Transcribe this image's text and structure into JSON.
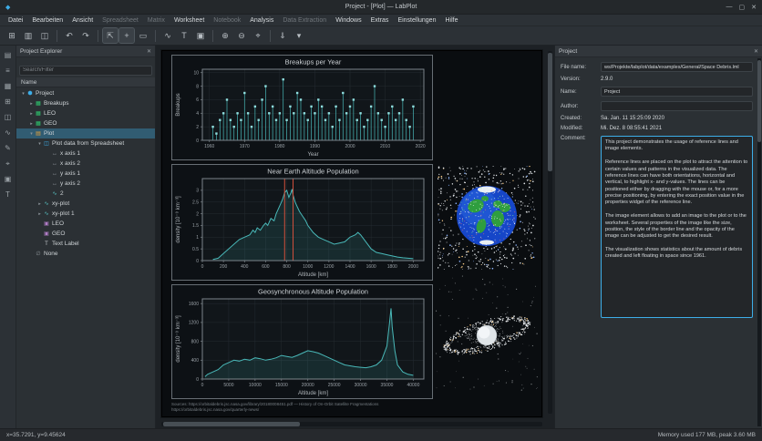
{
  "window": {
    "title": "Project - [Plot] — LabPlot",
    "controls": {
      "minimize": "—",
      "maximize": "▢",
      "close": "✕"
    }
  },
  "menubar": {
    "items": [
      {
        "label": "Datei",
        "dimmed": false
      },
      {
        "label": "Bearbeiten",
        "dimmed": false
      },
      {
        "label": "Ansicht",
        "dimmed": false
      },
      {
        "label": "Spreadsheet",
        "dimmed": true
      },
      {
        "label": "Matrix",
        "dimmed": true
      },
      {
        "label": "Worksheet",
        "dimmed": false
      },
      {
        "label": "Notebook",
        "dimmed": true
      },
      {
        "label": "Analysis",
        "dimmed": false
      },
      {
        "label": "Data Extraction",
        "dimmed": true
      },
      {
        "label": "Windows",
        "dimmed": false
      },
      {
        "label": "Extras",
        "dimmed": false
      },
      {
        "label": "Einstellungen",
        "dimmed": false
      },
      {
        "label": "Hilfe",
        "dimmed": false
      }
    ]
  },
  "toolbar": {
    "items": [
      {
        "name": "new-icon",
        "glyph": "⊞"
      },
      {
        "name": "open-icon",
        "glyph": "▥"
      },
      {
        "name": "save-icon",
        "glyph": "◫"
      },
      {
        "sep": true
      },
      {
        "name": "undo-icon",
        "glyph": "↶"
      },
      {
        "name": "redo-icon",
        "glyph": "↷"
      },
      {
        "sep": true
      },
      {
        "name": "select-mode-icon",
        "glyph": "⇱",
        "active": true
      },
      {
        "name": "pan-mode-icon",
        "glyph": "+",
        "active": true
      },
      {
        "name": "zoom-select-icon",
        "glyph": "▭"
      },
      {
        "sep": true
      },
      {
        "name": "add-plot-icon",
        "glyph": "∿"
      },
      {
        "name": "add-text-label-icon",
        "glyph": "T"
      },
      {
        "name": "add-image-icon",
        "glyph": "▣"
      },
      {
        "sep": true
      },
      {
        "name": "zoom-in-icon",
        "glyph": "⊕"
      },
      {
        "name": "zoom-out-icon",
        "glyph": "⊖"
      },
      {
        "name": "zoom-fit-icon",
        "glyph": "⌖"
      },
      {
        "sep": true
      },
      {
        "name": "export-icon",
        "glyph": "⇓"
      },
      {
        "name": "more-dropdown-icon",
        "glyph": "▾"
      }
    ]
  },
  "dock": {
    "items": [
      {
        "name": "dock-project-explorer-icon",
        "glyph": "▤"
      },
      {
        "name": "dock-properties-icon",
        "glyph": "≡"
      },
      {
        "name": "dock-spreadsheet-icon",
        "glyph": "▦"
      },
      {
        "name": "dock-matrix-icon",
        "glyph": "⊞"
      },
      {
        "name": "dock-worksheet-icon",
        "glyph": "◫"
      },
      {
        "name": "dock-plot-icon",
        "glyph": "∿"
      },
      {
        "name": "dock-notebook-icon",
        "glyph": "✎"
      },
      {
        "name": "dock-datapicker-icon",
        "glyph": "⌖"
      },
      {
        "name": "dock-image-icon",
        "glyph": "▣"
      },
      {
        "name": "dock-note-icon",
        "glyph": "T"
      }
    ]
  },
  "project_explorer": {
    "title": "Project Explorer",
    "search_placeholder": "Search/Filter",
    "column_header": "Name",
    "items": [
      {
        "label": "Project",
        "level": 0,
        "icon": "project",
        "expand": "open",
        "selected": false
      },
      {
        "label": "Breakups",
        "level": 1,
        "icon": "spreadsheet",
        "expand": "closed",
        "selected": false
      },
      {
        "label": "LEO",
        "level": 1,
        "icon": "spreadsheet",
        "expand": "closed",
        "selected": false
      },
      {
        "label": "GEO",
        "level": 1,
        "icon": "spreadsheet",
        "expand": "closed",
        "selected": false
      },
      {
        "label": "Plot",
        "level": 1,
        "icon": "worksheet",
        "expand": "open",
        "selected": true
      },
      {
        "label": "Plot data from Spreadsheet",
        "level": 2,
        "icon": "plot",
        "expand": "open",
        "selected": false
      },
      {
        "label": "x axis 1",
        "level": 3,
        "icon": "axis",
        "expand": null,
        "selected": false
      },
      {
        "label": "x axis 2",
        "level": 3,
        "icon": "axis",
        "expand": null,
        "selected": false
      },
      {
        "label": "y axis 1",
        "level": 3,
        "icon": "axis",
        "expand": null,
        "selected": false
      },
      {
        "label": "y axis 2",
        "level": 3,
        "icon": "axis",
        "expand": null,
        "selected": false
      },
      {
        "label": "2",
        "level": 3,
        "icon": "curve",
        "expand": null,
        "selected": false
      },
      {
        "label": "xy-plot",
        "level": 2,
        "icon": "curve",
        "expand": "closed",
        "selected": false
      },
      {
        "label": "xy-plot 1",
        "level": 2,
        "icon": "curve",
        "expand": "closed",
        "selected": false
      },
      {
        "label": "LEO",
        "level": 2,
        "icon": "image",
        "expand": null,
        "selected": false
      },
      {
        "label": "GEO",
        "level": 2,
        "icon": "image",
        "expand": null,
        "selected": false
      },
      {
        "label": "Text Label",
        "level": 2,
        "icon": "label",
        "expand": null,
        "selected": false
      },
      {
        "label": "None",
        "level": 1,
        "icon": "none",
        "expand": null,
        "selected": false
      }
    ]
  },
  "worksheet": {
    "source_lines": [
      "Sources: https://orbitaldebris.jsc.nasa.gov/library/20180008451.pdf — History of On-Orbit Satellite Fragmentations",
      "https://orbitaldebris.jsc.nasa.gov/quarterly-news/"
    ]
  },
  "chart_data": [
    {
      "type": "stem",
      "title": "Breakups per Year",
      "xlabel": "Year",
      "ylabel": "Breakups",
      "xlim": [
        1958,
        2021
      ],
      "ylim": [
        0,
        10.5
      ],
      "xticks": [
        1960,
        1970,
        1980,
        1990,
        2000,
        2010,
        2020
      ],
      "yticks": [
        0,
        2,
        4,
        6,
        8,
        10
      ],
      "grid": true,
      "x": [
        1961,
        1962,
        1963,
        1964,
        1965,
        1966,
        1967,
        1968,
        1969,
        1970,
        1971,
        1972,
        1973,
        1974,
        1975,
        1976,
        1977,
        1978,
        1979,
        1980,
        1981,
        1982,
        1983,
        1984,
        1985,
        1986,
        1987,
        1988,
        1989,
        1990,
        1991,
        1992,
        1993,
        1994,
        1995,
        1996,
        1997,
        1998,
        1999,
        2000,
        2001,
        2002,
        2003,
        2004,
        2005,
        2006,
        2007,
        2008,
        2009,
        2010,
        2011,
        2012,
        2013,
        2014,
        2015,
        2016,
        2017,
        2018
      ],
      "y": [
        2,
        1,
        3,
        4,
        6,
        3,
        2,
        4,
        3,
        7,
        4,
        2,
        5,
        3,
        6,
        8,
        4,
        5,
        3,
        4,
        9,
        3,
        5,
        4,
        7,
        6,
        4,
        3,
        5,
        4,
        6,
        5,
        3,
        4,
        2,
        5,
        3,
        7,
        4,
        5,
        6,
        3,
        4,
        2,
        3,
        5,
        8,
        4,
        3,
        2,
        4,
        5,
        3,
        4,
        6,
        3,
        2,
        5
      ]
    },
    {
      "type": "line",
      "title": "Near Earth Altitude Population",
      "xlabel": "Altitude [km]",
      "ylabel": "density [10⁻⁹ km⁻³]",
      "xlim": [
        0,
        2100
      ],
      "ylim": [
        0,
        3.5
      ],
      "xticks": [
        0,
        200,
        400,
        600,
        800,
        1000,
        1200,
        1400,
        1600,
        1800,
        2000
      ],
      "yticks": [
        0,
        0.5,
        1,
        1.5,
        2,
        2.5,
        3
      ],
      "grid": true,
      "ref_lines_x": [
        780,
        860
      ],
      "ref_color": "#d4503c",
      "x": [
        100,
        150,
        200,
        250,
        300,
        350,
        400,
        450,
        480,
        500,
        520,
        550,
        580,
        600,
        620,
        650,
        680,
        700,
        720,
        740,
        760,
        780,
        800,
        820,
        840,
        850,
        860,
        880,
        900,
        920,
        950,
        980,
        1000,
        1050,
        1100,
        1150,
        1200,
        1250,
        1300,
        1350,
        1400,
        1450,
        1475,
        1500,
        1550,
        1600,
        1650,
        1700,
        1750,
        1800,
        1850,
        1900,
        1950,
        2000
      ],
      "y": [
        0.05,
        0.1,
        0.3,
        0.5,
        0.7,
        0.9,
        1.0,
        1.1,
        1.3,
        1.2,
        1.4,
        1.3,
        1.5,
        1.6,
        1.5,
        1.8,
        1.7,
        2.0,
        2.2,
        2.4,
        2.6,
        2.9,
        3.0,
        2.7,
        2.9,
        3.05,
        2.8,
        2.5,
        2.3,
        2.1,
        1.9,
        1.7,
        1.5,
        1.2,
        1.0,
        0.9,
        0.8,
        0.7,
        0.75,
        0.8,
        1.0,
        1.1,
        1.2,
        1.1,
        0.8,
        0.5,
        0.35,
        0.3,
        0.25,
        0.2,
        0.15,
        0.12,
        0.1,
        0.08
      ]
    },
    {
      "type": "line",
      "title": "Geosynchronous Altitude Population",
      "xlabel": "Altitude [km]",
      "ylabel": "density [10⁻⁹ km⁻³]",
      "xlim": [
        0,
        42000
      ],
      "ylim": [
        0,
        1700
      ],
      "xticks": [
        0,
        5000,
        10000,
        15000,
        20000,
        25000,
        30000,
        35000,
        40000
      ],
      "yticks": [
        0,
        400,
        800,
        1200,
        1600
      ],
      "grid": true,
      "x": [
        500,
        1000,
        2000,
        3000,
        4000,
        5000,
        6000,
        7000,
        8000,
        9000,
        10000,
        11000,
        12000,
        13000,
        14000,
        15000,
        16000,
        17000,
        18000,
        19000,
        20000,
        21000,
        22000,
        23000,
        24000,
        25000,
        26000,
        27000,
        28000,
        29000,
        30000,
        31000,
        32000,
        33000,
        34000,
        35000,
        35500,
        35786,
        36000,
        36500,
        37000,
        38000,
        39000,
        40000
      ],
      "y": [
        50,
        100,
        150,
        200,
        300,
        350,
        400,
        380,
        420,
        400,
        450,
        430,
        400,
        420,
        450,
        500,
        480,
        460,
        500,
        550,
        600,
        580,
        550,
        500,
        450,
        400,
        350,
        300,
        280,
        260,
        250,
        240,
        260,
        300,
        400,
        700,
        1200,
        1500,
        1100,
        600,
        300,
        150,
        100,
        80
      ]
    }
  ],
  "properties": {
    "title": "Project",
    "fields": {
      "file_name_label": "File name:",
      "file_name": "ws/Projekte/labplot/data/examples/General/Space Debris.lml",
      "version_label": "Version:",
      "version": "2.9.0",
      "name_label": "Name:",
      "name": "Project",
      "author_label": "Author:",
      "author": "",
      "created_label": "Created:",
      "created": "Sa. Jan. 11 15:25:09 2020",
      "modified_label": "Modified:",
      "modified": "Mi. Dez. 8 08:55:41 2021",
      "comment_label": "Comment:",
      "comment": "This project demonstrates the usage of reference lines and image elements.\n\nReference lines are placed on the plot to attract the attention to certain values and patterns in the visualized data. The reference lines can have both orientations, horizontal and vertical, to highlight x- and y-values. The lines can be positioned either by dragging with the mouse or, for a more precise positioning, by entering the exact position value in the properties widget of the reference line.\n\nThe image element allows to add an image to the plot or to the worksheet. Several properties of the image like the size, position, the style of the border line and the opacity of the image can be adjusted to get the desired result.\n\nThe visualization shows statistics about the amount of debris created and left floating in space since 1961."
    }
  },
  "statusbar": {
    "left": "x=35.7291, y=9.45624",
    "right": "Memory used 177 MB, peak 3.60 MB"
  },
  "colors": {
    "accent": "#3daee9",
    "curve": "#49b8b8",
    "marker": "#8fdede",
    "reference_line": "#d4503c"
  }
}
